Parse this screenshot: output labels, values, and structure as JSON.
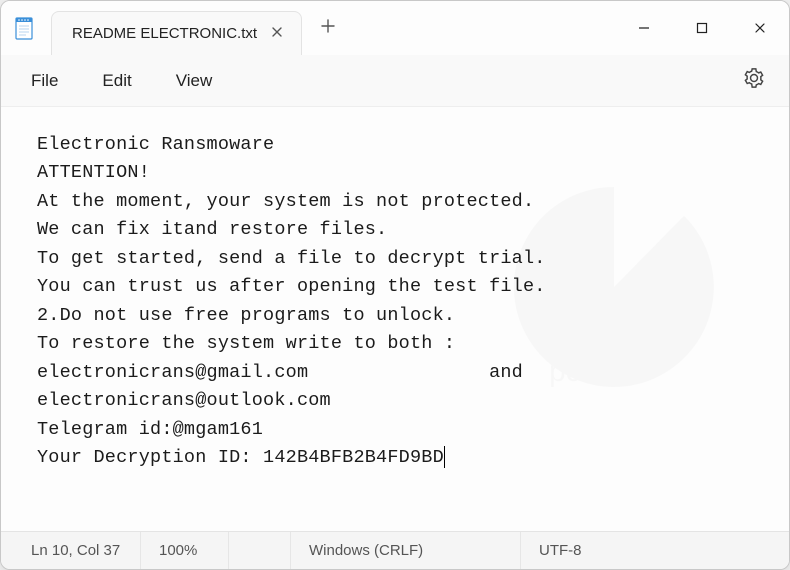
{
  "window": {
    "tab_title": "README ELECTRONIC.txt"
  },
  "menu": {
    "file": "File",
    "edit": "Edit",
    "view": "View"
  },
  "document": {
    "lines": [
      "Electronic Ransmoware",
      "ATTENTION!",
      "At the moment, your system is not protected.",
      "We can fix itand restore files.",
      "To get started, send a file to decrypt trial.",
      "You can trust us after opening the test file.",
      "2.Do not use free programs to unlock.",
      "To restore the system write to both :",
      "electronicrans@gmail.com                and",
      "electronicrans@outlook.com",
      "Telegram id:@mgam161",
      "Your Decryption ID: 142B4BFB2B4FD9BD"
    ]
  },
  "status": {
    "position": "Ln 10, Col 37",
    "zoom": "100%",
    "line_ending": "Windows (CRLF)",
    "encoding": "UTF-8"
  }
}
